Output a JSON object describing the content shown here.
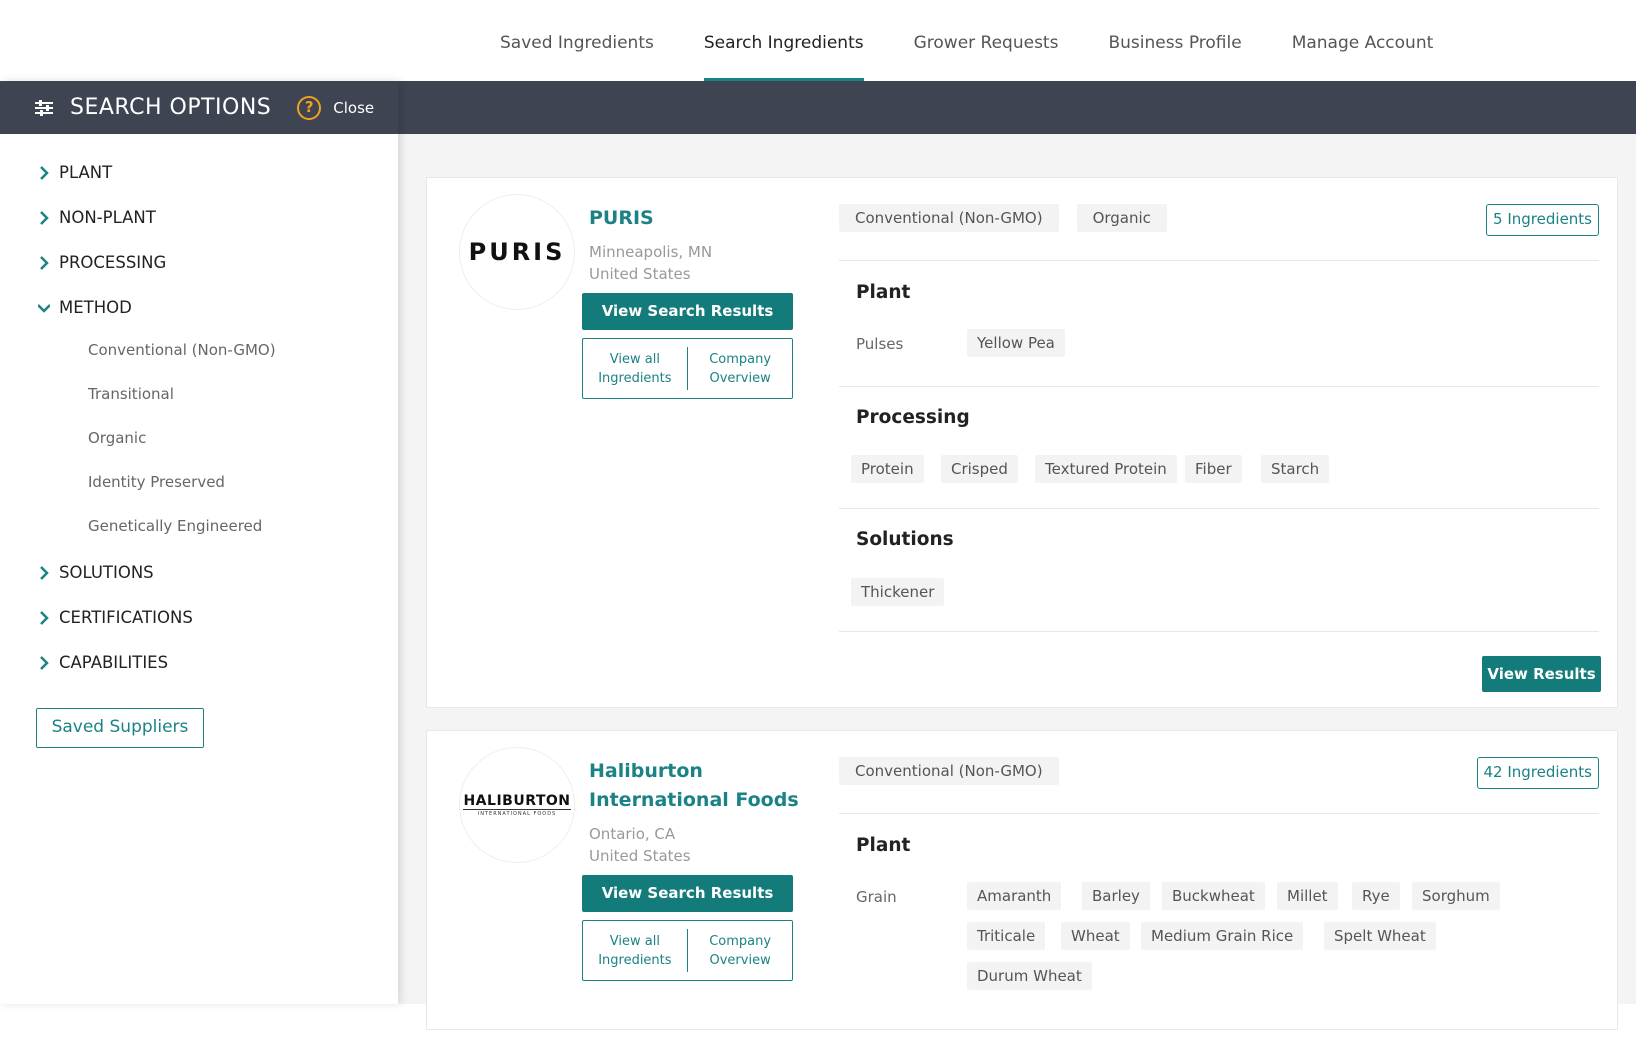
{
  "topnav": {
    "tabs": [
      {
        "label": "Saved Ingredients"
      },
      {
        "label": "Search Ingredients"
      },
      {
        "label": "Grower Requests"
      },
      {
        "label": "Business Profile"
      },
      {
        "label": "Manage Account"
      }
    ],
    "active_tab": "Search Ingredients"
  },
  "sidebar": {
    "title": "SEARCH OPTIONS",
    "help_glyph": "?",
    "close_label": "Close",
    "categories": [
      {
        "label": "PLANT"
      },
      {
        "label": "NON-PLANT"
      },
      {
        "label": "PROCESSING"
      },
      {
        "label": "METHOD",
        "expanded": true
      }
    ],
    "method_items": [
      "Conventional (Non-GMO)",
      "Transitional",
      "Organic",
      "Identity Preserved",
      "Genetically Engineered"
    ],
    "more_categories": [
      {
        "label": "SOLUTIONS"
      },
      {
        "label": "CERTIFICATIONS"
      },
      {
        "label": "CAPABILITIES"
      }
    ],
    "saved_suppliers_label": "Saved Suppliers"
  },
  "results": [
    {
      "name": "PURIS",
      "logo_text": "PURIS",
      "city": "Minneapolis, MN",
      "country": "United States",
      "view_search_results_label": "View Search Results",
      "view_all_label_1": "View all",
      "view_all_label_2": "Ingredients",
      "overview_label_1": "Company",
      "overview_label_2": "Overview",
      "methods": [
        "Conventional (Non-GMO)",
        "Organic"
      ],
      "ingredient_count_label": "5 Ingredients",
      "plant_title": "Plant",
      "plant_row_label": "Pulses",
      "plant_chips": [
        "Yellow Pea"
      ],
      "processing_title": "Processing",
      "processing_chips": [
        "Protein",
        "Crisped",
        "Textured Protein",
        "Fiber",
        "Starch"
      ],
      "solutions_title": "Solutions",
      "solutions_chips": [
        "Thickener"
      ],
      "view_results_label": "View Results"
    },
    {
      "name_line1": "Haliburton",
      "name_line2": "International Foods",
      "logo_text": "HALIBURTON",
      "logo_sub": "INTERNATIONAL FOODS",
      "city": "Ontario, CA",
      "country": "United States",
      "view_search_results_label": "View Search Results",
      "view_all_label_1": "View all",
      "view_all_label_2": "Ingredients",
      "overview_label_1": "Company",
      "overview_label_2": "Overview",
      "methods": [
        "Conventional (Non-GMO)"
      ],
      "ingredient_count_label": "42 Ingredients",
      "plant_title": "Plant",
      "plant_row_label": "Grain",
      "plant_chips": [
        "Amaranth",
        "Barley",
        "Buckwheat",
        "Millet",
        "Rye",
        "Sorghum",
        "Triticale",
        "Wheat",
        "Medium Grain Rice",
        "Spelt Wheat",
        "Durum Wheat"
      ]
    }
  ],
  "colors": {
    "accent": "#1b8285",
    "button": "#137b7a",
    "header_bar": "#3f4453",
    "help": "#f0a21c"
  }
}
